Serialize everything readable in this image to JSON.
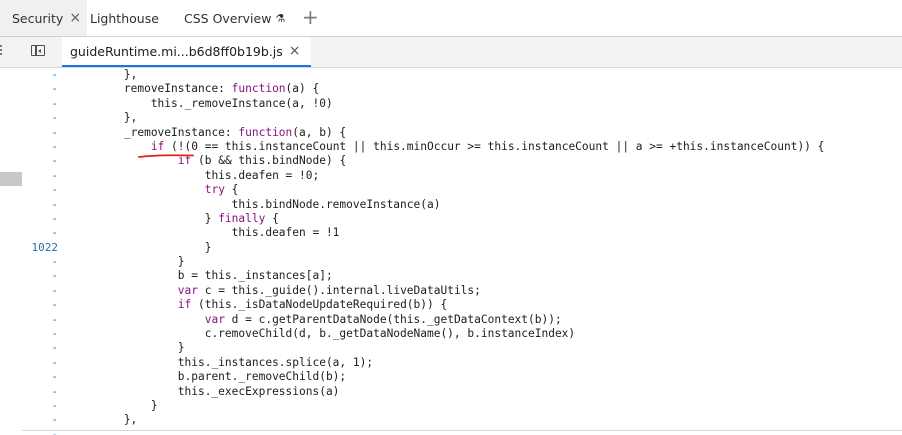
{
  "tabs": [
    {
      "label": "Security",
      "active": true,
      "closable": true
    },
    {
      "label": "Lighthouse",
      "active": false,
      "closable": false
    },
    {
      "label": "CSS Overview",
      "active": false,
      "closable": false,
      "icon": "flask-icon"
    }
  ],
  "new_tab_symbol": "+",
  "file_tab": {
    "label": "guideRuntime.mi...b6d8ff0b19b.js",
    "close_symbol": "×"
  },
  "close_symbol": "×",
  "flask_symbol": "⚗",
  "line_numbers": [
    "-",
    "-",
    "-",
    "-",
    "-",
    "-",
    "-",
    "-",
    "-",
    "-",
    "-",
    "-",
    "1022",
    "-",
    "-",
    "-",
    "-",
    "-",
    "-",
    "-",
    "-",
    "-",
    "-",
    "-",
    "-",
    "-"
  ],
  "code_lines": [
    "        },",
    "        removeInstance: function(a) {",
    "            this._removeInstance(a, !0)",
    "        },",
    "        _removeInstance: function(a, b) {",
    "            if (!(0 == this.instanceCount || this.minOccur >= this.instanceCount || a >= +this.instanceCount)) {",
    "                if (b && this.bindNode) {",
    "                    this.deafen = !0;",
    "                    try {",
    "                        this.bindNode.removeInstance(a)",
    "                    } finally {",
    "                        this.deafen = !1",
    "                    }",
    "                }",
    "                b = this._instances[a];",
    "                var c = this._guide().internal.liveDataUtils;",
    "                if (this._isDataNodeUpdateRequired(b)) {",
    "                    var d = c.getParentDataNode(this._getDataContext(b));",
    "                    c.removeChild(d, b._getDataNodeName(), b.instanceIndex)",
    "                }",
    "                this._instances.splice(a, 1);",
    "                b.parent._removeChild(b);",
    "                this._execExpressions(a)",
    "            }",
    "        },"
  ],
  "colors": {
    "keyword": "#881280",
    "line_number": "#2b6ea8",
    "annotation": "#e0201a",
    "active_tab_underline": "#1a73e8"
  }
}
